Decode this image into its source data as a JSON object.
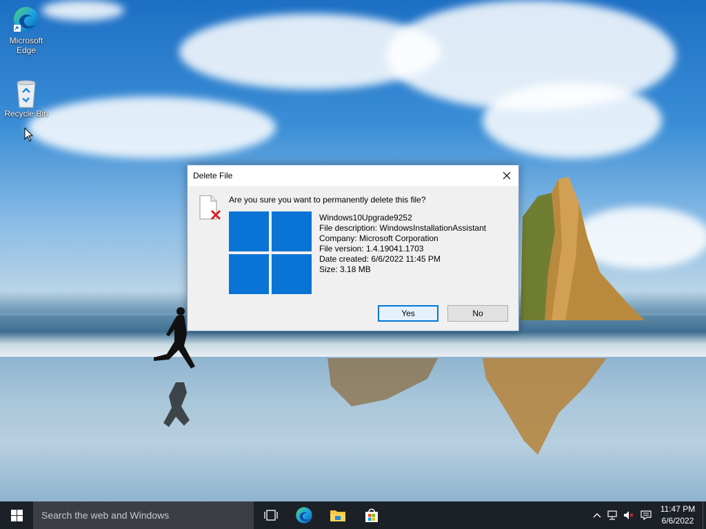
{
  "desktop": {
    "icons": [
      {
        "label": "Microsoft\nEdge",
        "line1": "Microsoft",
        "line2": "Edge",
        "icon": "edge-icon"
      },
      {
        "label": "Recycle Bin",
        "icon": "recycle-bin-icon"
      }
    ]
  },
  "dialog": {
    "title": "Delete File",
    "question": "Are you sure you want to permanently delete this file?",
    "file_name": "Windows10Upgrade9252",
    "description": "File description: WindowsInstallationAssistant",
    "company": "Company: Microsoft Corporation",
    "version": "File version: 1.4.19041.1703",
    "created": "Date created: 6/6/2022 11:45 PM",
    "size": "Size: 3.18 MB",
    "yes_label": "Yes",
    "no_label": "No"
  },
  "taskbar": {
    "search_placeholder": "Search the web and Windows",
    "pinned": [
      "task-view-icon",
      "edge-icon",
      "file-explorer-icon",
      "store-icon"
    ],
    "tray": [
      "chevron-up-icon",
      "network-icon",
      "volume-muted-icon",
      "action-center-icon"
    ],
    "time": "11:47 PM",
    "date": "6/6/2022"
  },
  "colors": {
    "accent": "#0078d7",
    "taskbar": "#1c2127",
    "dialog_bg": "#f0f0f0"
  }
}
